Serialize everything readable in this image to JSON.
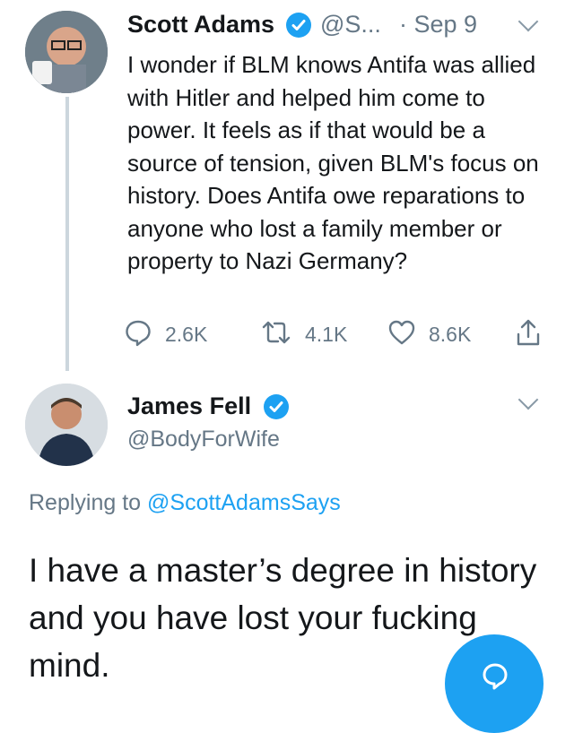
{
  "tweet": {
    "author_name": "Scott Adams",
    "handle_truncated": "@S...",
    "date": "· Sep 9",
    "text": "I wonder if BLM knows Antifa was allied with Hitler and helped him come to power. It feels as if that would be a source of tension, given BLM's focus on history. Does Antifa owe reparations to anyone who lost a family member or property to Nazi Germany?",
    "replies": "2.6K",
    "retweets": "4.1K",
    "likes": "8.6K",
    "verified": true
  },
  "reply": {
    "author_name": "James Fell",
    "handle": "@BodyForWife",
    "verified": true,
    "replying_prefix": "Replying to",
    "replying_handle": "@ScottAdamsSays",
    "text": "I have a master’s degree in history and you have lost your fucking mind."
  },
  "icons": {
    "reply": "reply-bubble-icon",
    "retweet": "retweet-icon",
    "like": "heart-icon",
    "share": "share-icon",
    "verified": "verified-badge-icon",
    "more": "chevron-down-icon",
    "compose": "compose-reply-icon"
  },
  "colors": {
    "accent": "#1da1f2",
    "text": "#14171a",
    "muted": "#657786",
    "thread_line": "#ccd6dd"
  }
}
